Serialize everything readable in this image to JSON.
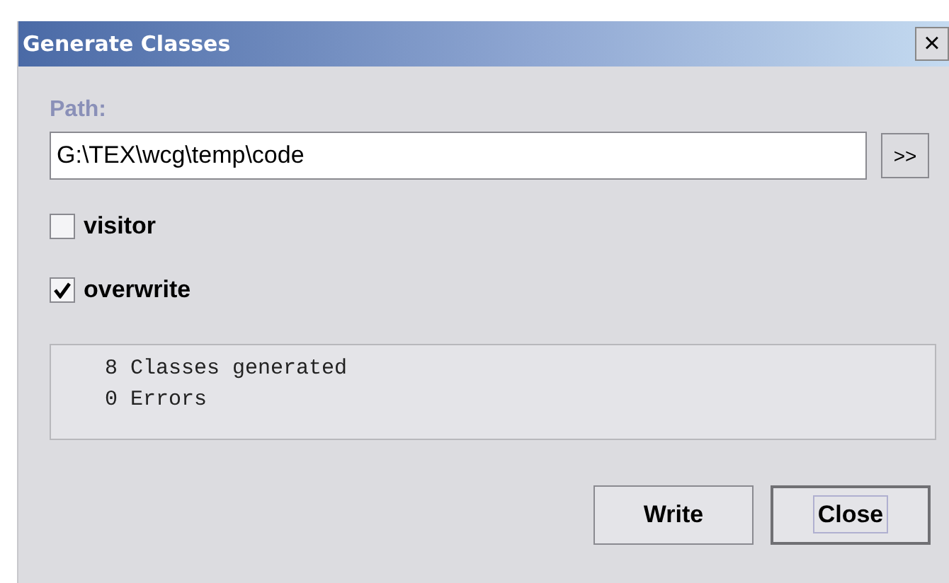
{
  "window": {
    "title": "Generate Classes",
    "close_glyph": "×"
  },
  "path": {
    "label": "Path:",
    "value": "G:\\TEX\\wcg\\temp\\code",
    "browse_label": ">>"
  },
  "options": [
    {
      "label": "visitor",
      "checked": false
    },
    {
      "label": "overwrite",
      "checked": true
    }
  ],
  "output": [
    "8 Classes generated",
    "0 Errors"
  ],
  "buttons": [
    {
      "label": "Write",
      "focused": false
    },
    {
      "label": "Close",
      "focused": true
    }
  ]
}
